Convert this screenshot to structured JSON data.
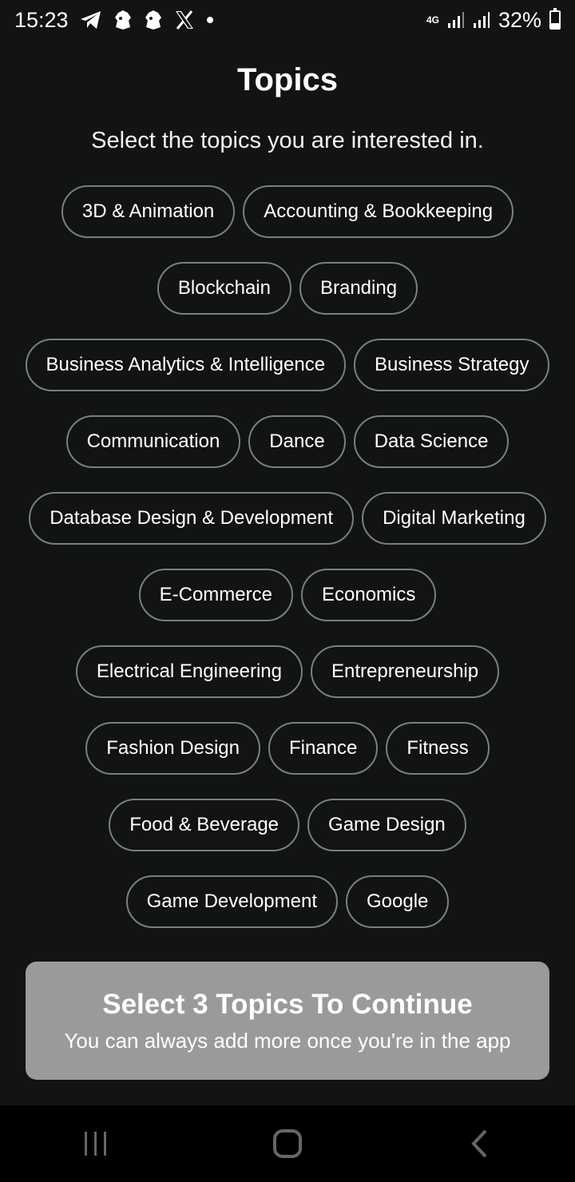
{
  "status_bar": {
    "time": "15:23",
    "network": "4G",
    "battery": "32%",
    "battery_level": 0.32,
    "notification_icons": [
      "telegram-icon",
      "premier-league-icon",
      "premier-league-icon",
      "x-icon",
      "dot-icon"
    ]
  },
  "header": {
    "title": "Topics",
    "subtitle": "Select the topics you are interested in."
  },
  "topics": [
    [
      "3D & Animation",
      "Accounting & Bookkeeping"
    ],
    [
      "Blockchain",
      "Branding"
    ],
    [
      "Business Analytics & Intelligence",
      "Business Strategy"
    ],
    [
      "Communication",
      "Dance",
      "Data Science"
    ],
    [
      "Database Design & Development",
      "Digital Marketing"
    ],
    [
      "E-Commerce",
      "Economics"
    ],
    [
      "Electrical Engineering",
      "Entrepreneurship"
    ],
    [
      "Fashion Design",
      "Finance",
      "Fitness"
    ],
    [
      "Food & Beverage",
      "Game Design"
    ],
    [
      "Game Development",
      "Google"
    ]
  ],
  "toast": {
    "title": "Select 3 Topics To Continue",
    "subtitle": "You can always add more once you're in the app"
  },
  "colors": {
    "background": "#121414",
    "chip_border": "#7c7f7f",
    "toast_bg": "#9a9a9a",
    "nav_bg": "#000000"
  }
}
